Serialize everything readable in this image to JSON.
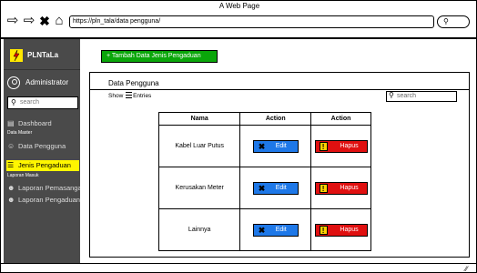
{
  "browser": {
    "title": "A Web Page",
    "url": "https://pln_tala/data pengguna/",
    "back_icon": "back-arrow-icon",
    "forward_icon": "forward-arrow-icon",
    "close_icon": "close-icon",
    "home_icon": "home-icon",
    "search_icon": "search-icon"
  },
  "sidebar": {
    "brand": "PLNTaLa",
    "user": "Administrator",
    "search_placeholder": "search",
    "dashboard": "Dashboard",
    "section_master": "Data Master",
    "data_pengguna": "Data Pengguna",
    "jenis_pengaduan": "Jenis Pengaduan",
    "section_laporan": "Laporan Masuk",
    "laporan_pemasangan": "Laporan Pemasangan",
    "laporan_pengaduan": "Laporan Pengaduan"
  },
  "main": {
    "add_button": "+ Tambah Data Jenis Pengaduan",
    "card_title": "Data Pengguna",
    "show": "Show",
    "entries": "Entries",
    "search_placeholder": "search",
    "table": {
      "headers": [
        "Nama",
        "Action",
        "Action"
      ],
      "rows": [
        {
          "nama": "Kabel Luar Putus",
          "edit": "Edit",
          "hapus": "Hapus"
        },
        {
          "nama": "Kerusakan Meter",
          "edit": "Edit",
          "hapus": "Hapus"
        },
        {
          "nama": "Lainnya",
          "edit": "Edit",
          "hapus": "Hapus"
        }
      ]
    }
  },
  "colors": {
    "sidebar_bg": "#4a4a4a",
    "active_item": "#fff600",
    "add_button": "#0aa60a",
    "edit_button": "#1e78e8",
    "hapus_button": "#e01010"
  }
}
